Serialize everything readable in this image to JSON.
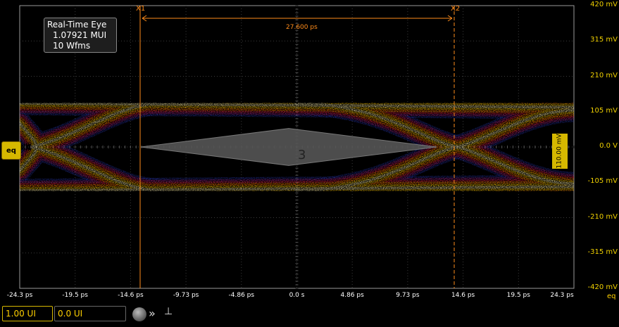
{
  "info_box": {
    "title": "Real-Time Eye",
    "unit_intervals": "1.07921 MUI",
    "waveforms": "10 Wfms"
  },
  "cursors": {
    "x1_label": "X1",
    "x2_label": "X2",
    "delta_label": "27.600 ps",
    "color": "#ff8c1a"
  },
  "y_axis": {
    "labels": [
      "420 mV",
      "315 mV",
      "210 mV",
      "105 mV",
      "0.0 V",
      "-105 mV",
      "-210 mV",
      "-315 mV",
      "-420 mV"
    ],
    "color": "#f0d000"
  },
  "x_axis": {
    "labels": [
      "-24.3 ps",
      "-19.5 ps",
      "-14.6 ps",
      "-9.73 ps",
      "-4.86 ps",
      "0.0 s",
      "4.86 ps",
      "9.73 ps",
      "14.6 ps",
      "19.5 ps",
      "24.3 ps"
    ],
    "eq_label": "eq"
  },
  "channel_badge": {
    "label": "eq",
    "icon": "channel-marker-icon",
    "color": "#d6b800"
  },
  "eye_mask_label": "3",
  "measurement_tag": "110.00 mV",
  "bottom_bar": {
    "field1": "1.00 UI",
    "field2": "0.0 UI",
    "knob_icon": "knob-icon",
    "chevron_icon": "double-chevron-right-icon",
    "pin_icon": "pin-icon"
  }
}
